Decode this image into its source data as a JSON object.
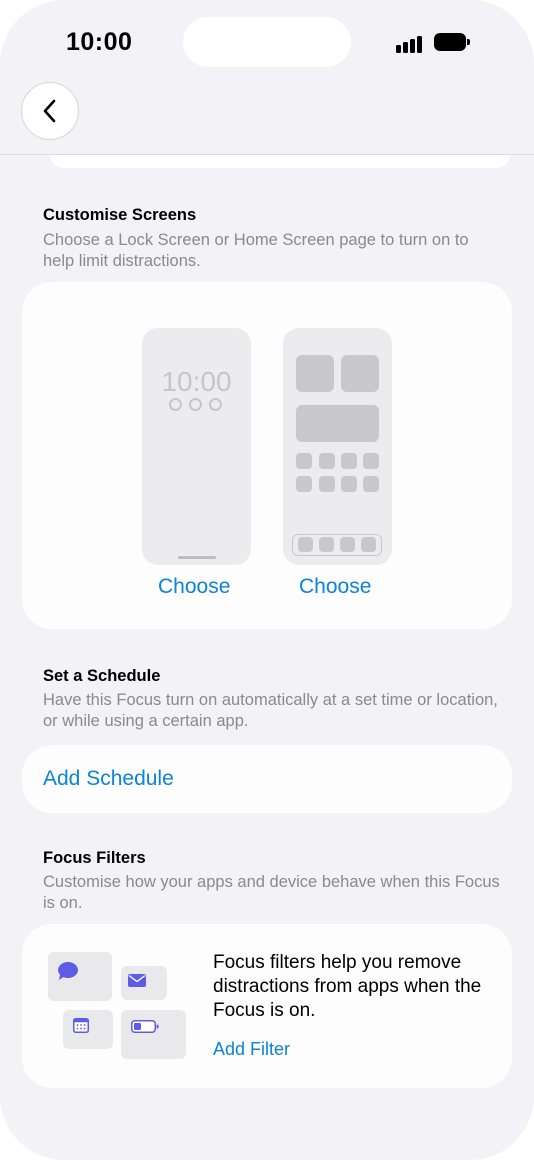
{
  "status_bar": {
    "time": "10:00"
  },
  "nav": {
    "back_icon": "chevron-left-icon"
  },
  "customise_screens": {
    "title": "Customise Screens",
    "description": "Choose a Lock Screen or Home Screen page to turn on to help limit distractions.",
    "lock_screen_time": "10:00",
    "lock_choose_label": "Choose",
    "home_choose_label": "Choose"
  },
  "schedule": {
    "title": "Set a Schedule",
    "description": "Have this Focus turn on automatically at a set time or location, or while using a certain app.",
    "add_label": "Add Schedule"
  },
  "focus_filters": {
    "title": "Focus Filters",
    "description": "Customise how your apps and device behave when this Focus is on.",
    "info_text": "Focus filters help you remove distractions from apps when the Focus is on.",
    "add_label": "Add Filter",
    "icons": [
      "message-bubble-icon",
      "mail-icon",
      "calendar-icon",
      "battery-icon"
    ]
  },
  "colors": {
    "accent": "#0a84d6",
    "icon_purple": "#5e5ce6",
    "background": "#f2f2f7"
  }
}
